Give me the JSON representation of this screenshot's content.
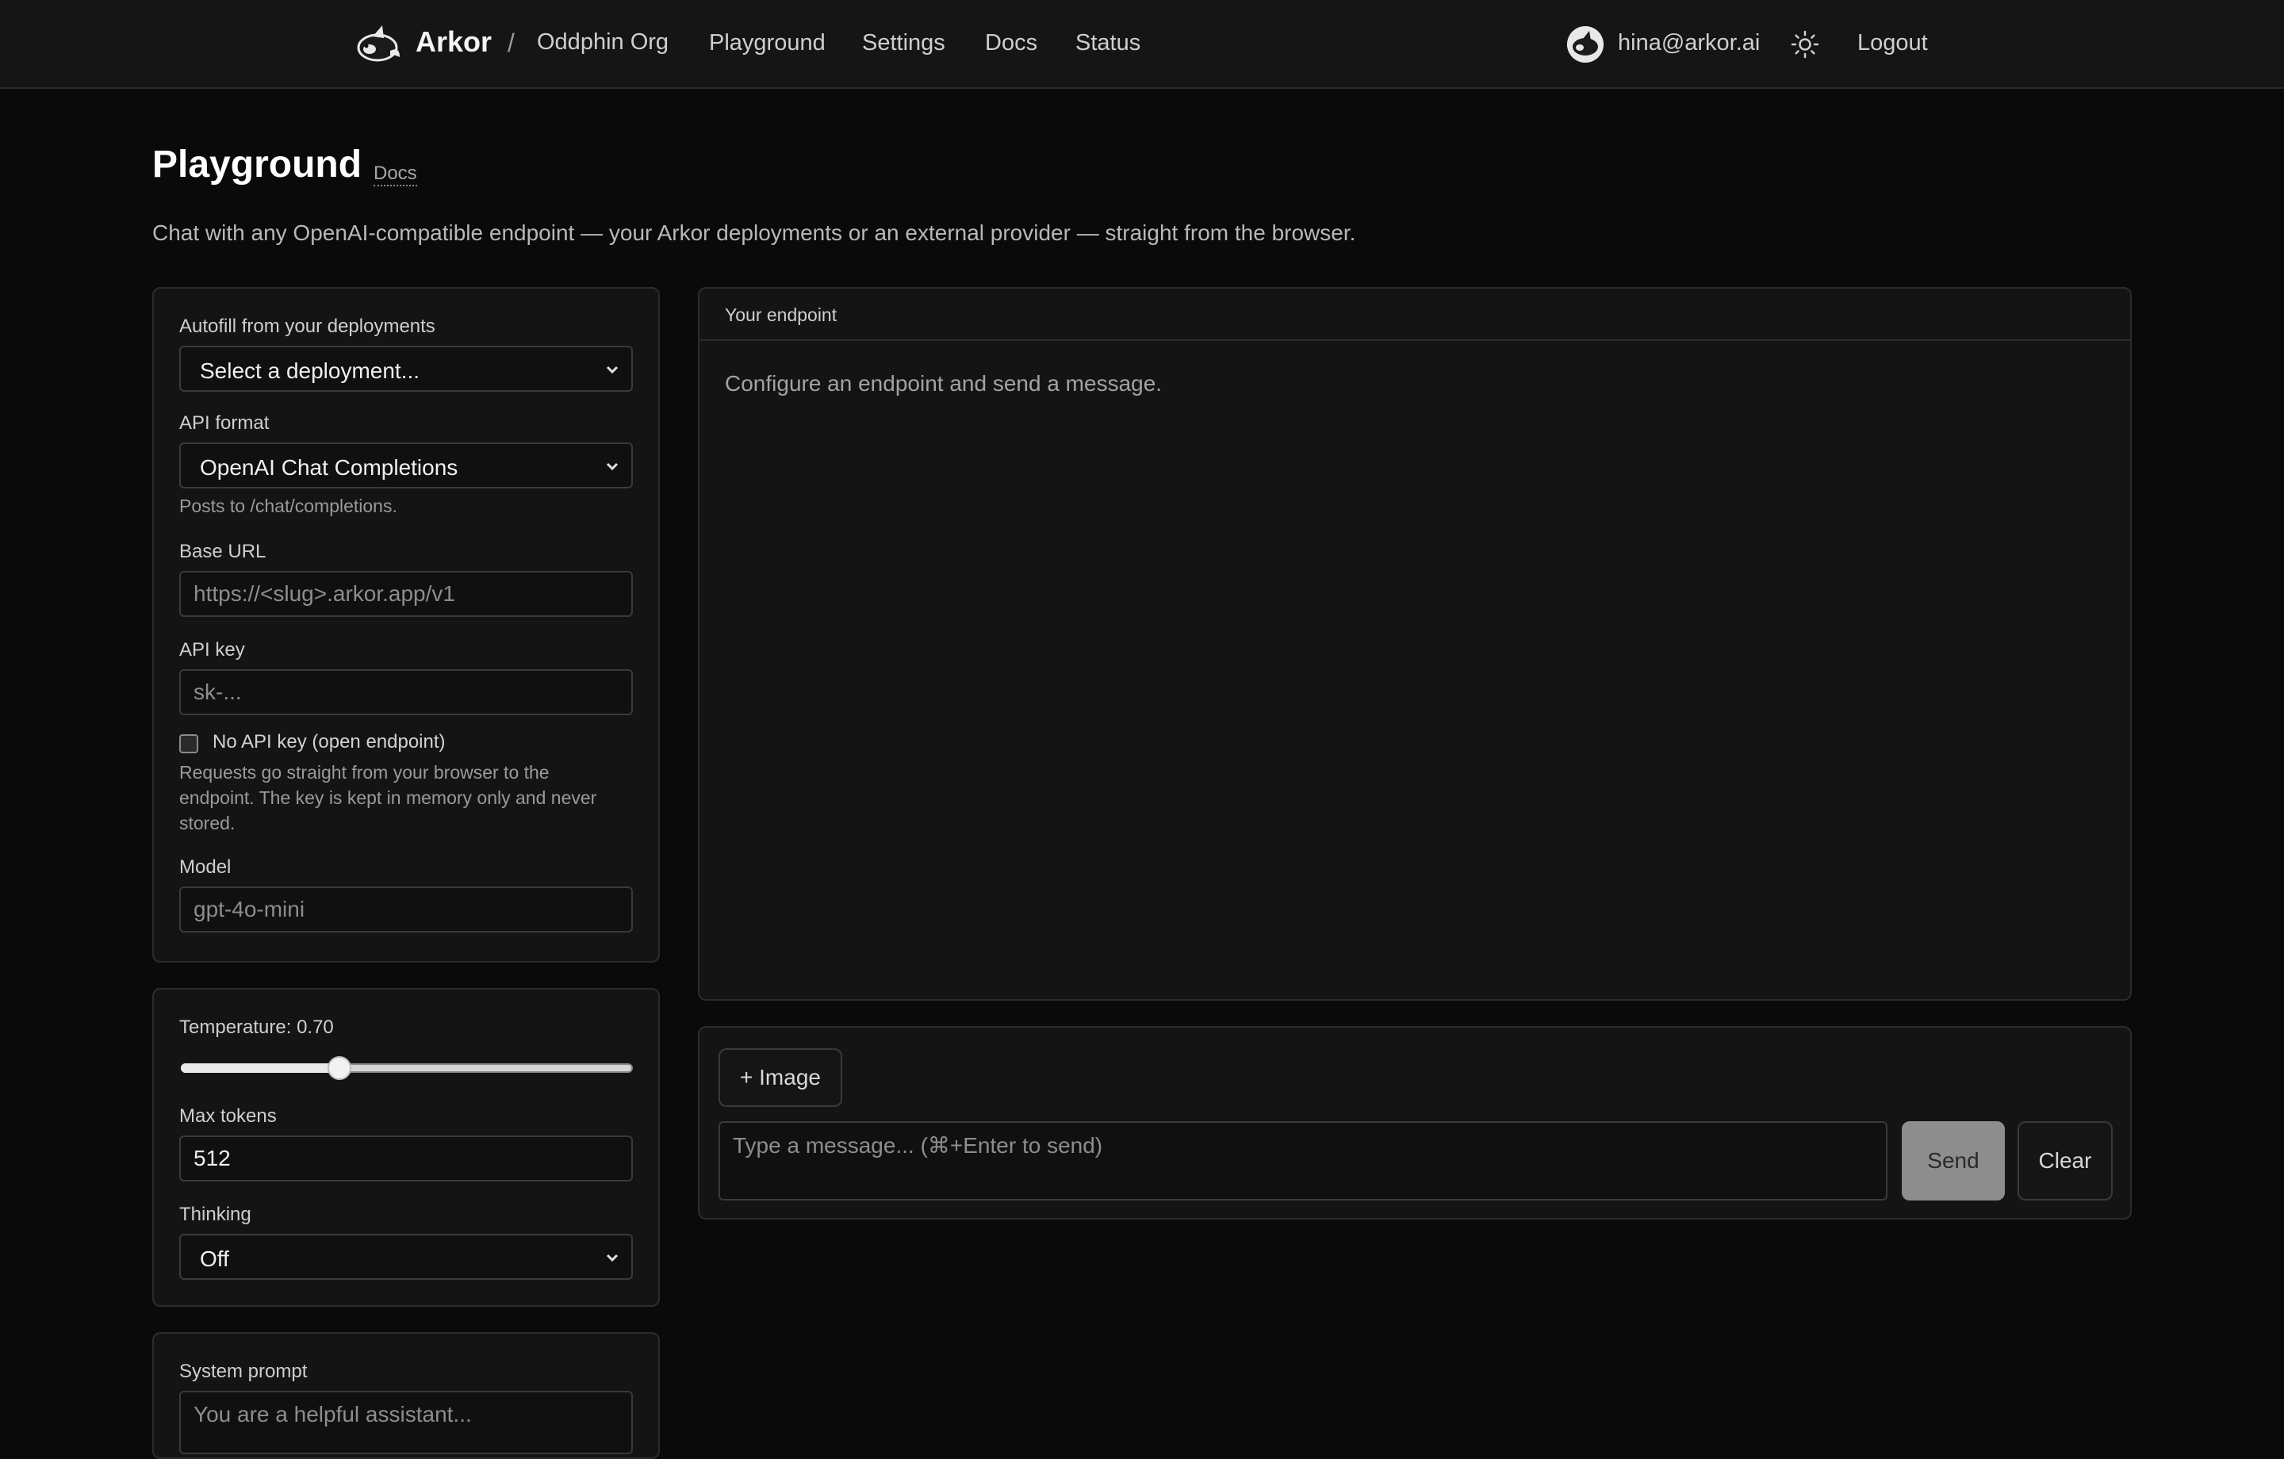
{
  "nav": {
    "brand": "Arkor",
    "separator": "/",
    "org": "Oddphin Org",
    "links": [
      "Playground",
      "Settings",
      "Docs",
      "Status"
    ],
    "user_email": "hina@arkor.ai",
    "logout": "Logout",
    "icons": {
      "brand": "orca-logo-icon",
      "avatar": "orca-avatar-icon",
      "theme": "sun-icon"
    }
  },
  "page": {
    "title": "Playground",
    "docs_link": "Docs",
    "subtitle": "Chat with any OpenAI-compatible endpoint — your Arkor deployments or an external provider — straight from the browser."
  },
  "config": {
    "autofill_label": "Autofill from your deployments",
    "autofill_value": "Select a deployment...",
    "api_format_label": "API format",
    "api_format_value": "OpenAI Chat Completions",
    "api_format_hint": "Posts to /chat/completions.",
    "base_url_label": "Base URL",
    "base_url_placeholder": "https://<slug>.arkor.app/v1",
    "api_key_label": "API key",
    "api_key_placeholder": "sk-...",
    "no_key_label": "No API key (open endpoint)",
    "no_key_checked": false,
    "key_hint": "Requests go straight from your browser to the endpoint. The key is kept in memory only and never stored.",
    "model_label": "Model",
    "model_placeholder": "gpt-4o-mini"
  },
  "params": {
    "temperature_label": "Temperature: 0.70",
    "temperature_value": 0.7,
    "temperature_min": 0,
    "temperature_max": 2,
    "max_tokens_label": "Max tokens",
    "max_tokens_value": "512",
    "thinking_label": "Thinking",
    "thinking_value": "Off"
  },
  "system": {
    "label": "System prompt",
    "placeholder": "You are a helpful assistant..."
  },
  "chat": {
    "header": "Your endpoint",
    "empty_text": "Configure an endpoint and send a message.",
    "image_button": "+ Image",
    "message_placeholder": "Type a message... (⌘+Enter to send)",
    "send_button": "Send",
    "clear_button": "Clear"
  },
  "colors": {
    "background": "#0a0a0a",
    "panel": "#141414",
    "border": "#2c2c2c",
    "send_disabled": "#8d8d8d"
  }
}
